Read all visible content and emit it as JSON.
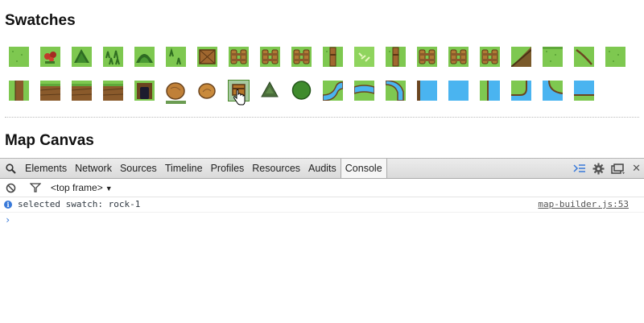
{
  "swatches_title": "Swatches",
  "map_canvas_title": "Map Canvas",
  "swatches_row1": [
    "grass",
    "flower",
    "bush-dark",
    "grass-tuft",
    "fern",
    "sprout",
    "crate",
    "fence-double",
    "fence",
    "fence-post-double",
    "post",
    "sparkle",
    "post-single",
    "fence-wide",
    "fence-pair",
    "fence-narrow",
    "slope",
    "grass-edge",
    "root",
    "grass-plain"
  ],
  "swatches_row2": [
    "cliff-a",
    "cliff-b",
    "cliff-c",
    "cliff-d",
    "cave",
    "rock-1",
    "rock-2",
    "chest",
    "tree-pine",
    "tree-round",
    "river-bend",
    "river-h",
    "river-curve",
    "water-edge-l",
    "water",
    "water-edge-r",
    "water-corner",
    "water-corner-b",
    "water-bottom"
  ],
  "selected_swatch": "chest",
  "devtools": {
    "tabs": [
      "Elements",
      "Network",
      "Sources",
      "Timeline",
      "Profiles",
      "Resources",
      "Audits",
      "Console"
    ],
    "active_tab": "Console",
    "frame_selector": "<top frame>",
    "console_messages": [
      {
        "text": "selected swatch: rock-1",
        "source": "map-builder.js:53",
        "level": "info"
      }
    ],
    "prompt_symbol": "›"
  },
  "colors": {
    "grass": "#7ec850",
    "grass_dark": "#5fa83a",
    "dirt": "#8a5a2b",
    "water": "#4ab4f0",
    "accent": "#3879d9"
  }
}
